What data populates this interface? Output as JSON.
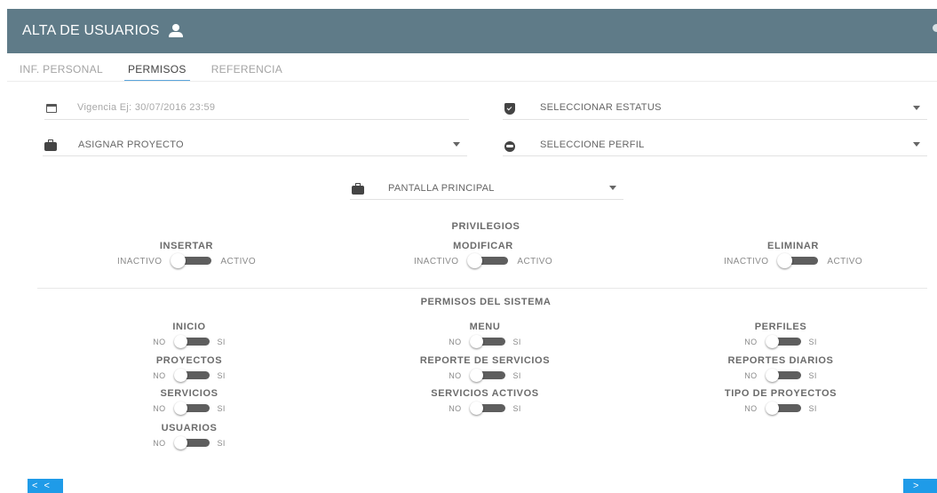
{
  "header": {
    "title": "ALTA DE USUARIOS"
  },
  "tabs": [
    {
      "label": "INF. PERSONAL"
    },
    {
      "label": "PERMISOS"
    },
    {
      "label": "REFERENCIA"
    }
  ],
  "fields": {
    "vigencia": {
      "placeholder": "Vigencia Ej: 30/07/2016 23:59"
    },
    "estatus": {
      "value": "SELECCIONAR ESTATUS"
    },
    "proyecto": {
      "value": "ASIGNAR PROYECTO"
    },
    "perfil": {
      "value": "SELECCIONE PERFIL"
    },
    "pantalla": {
      "value": "PANTALLA PRINCIPAL"
    }
  },
  "privilegios": {
    "title": "PRIVILEGIOS",
    "off_label": "INACTIVO",
    "on_label": "ACTIVO",
    "items": [
      {
        "label": "INSERTAR",
        "active": false
      },
      {
        "label": "MODIFICAR",
        "active": false
      },
      {
        "label": "ELIMINAR",
        "active": false
      }
    ]
  },
  "permisos": {
    "title": "PERMISOS DEL SISTEMA",
    "off_label": "NO",
    "on_label": "SI",
    "items": [
      {
        "label": "INICIO",
        "active": false
      },
      {
        "label": "MENU",
        "active": false
      },
      {
        "label": "PERFILES",
        "active": false
      },
      {
        "label": "PROYECTOS",
        "active": false
      },
      {
        "label": "REPORTE DE SERVICIOS",
        "active": false
      },
      {
        "label": "REPORTES DIARIOS",
        "active": false
      },
      {
        "label": "SERVICIOS",
        "active": false
      },
      {
        "label": "SERVICIOS ACTIVOS",
        "active": false
      },
      {
        "label": "TIPO DE PROYECTOS",
        "active": false
      },
      {
        "label": "USUARIOS",
        "active": false
      }
    ]
  },
  "nav": {
    "prev_label": "< <",
    "next_label": ">"
  },
  "colors": {
    "header": "#5f7b88",
    "accent": "#1f9be8",
    "tab_underline": "#5aa4dc"
  }
}
